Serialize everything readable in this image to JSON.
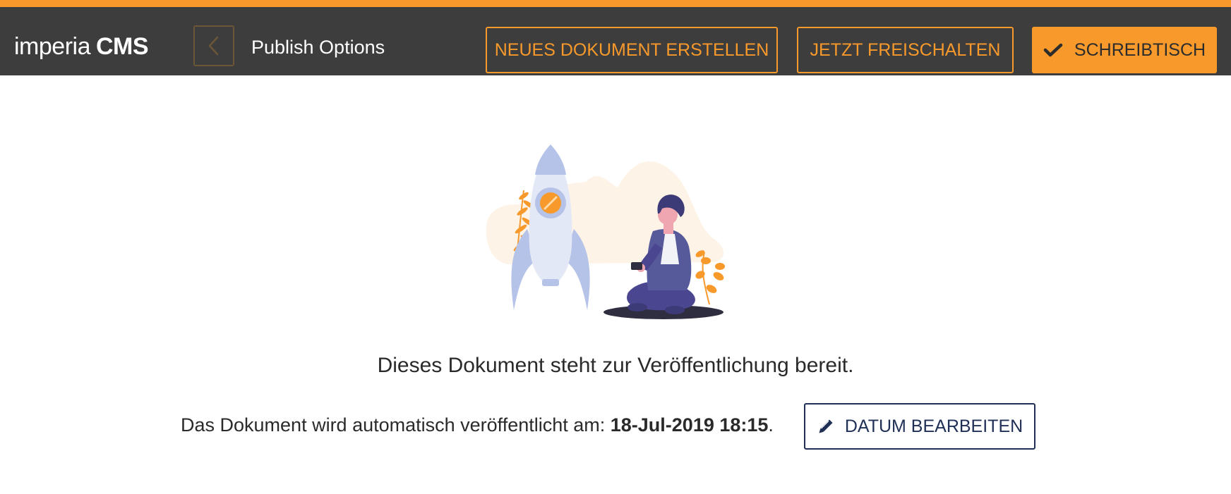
{
  "colors": {
    "accent": "#f7992b",
    "topbar": "#3d3d3d",
    "navy": "#1f2f56",
    "text": "#2a2a2a"
  },
  "header": {
    "logo_light": "imperia",
    "logo_bold": "CMS",
    "back_icon": "chevron-left-icon",
    "title": "Publish Options",
    "buttons": {
      "new_document": "NEUES DOKUMENT ERSTELLEN",
      "unlock_now": "JETZT FREISCHALTEN",
      "desk_icon": "checkmark-icon",
      "desk": "SCHREIBTISCH"
    }
  },
  "main": {
    "illustration": "rocket-launch-illustration",
    "headline": "Dieses Dokument steht zur Veröffentlichung bereit.",
    "publish_prefix": "Das Dokument wird automatisch veröffentlicht am: ",
    "publish_date": "18-Jul-2019 18:15",
    "publish_suffix": ".",
    "edit_date_icon": "pencil-icon",
    "edit_date_button": "DATUM BEARBEITEN"
  }
}
